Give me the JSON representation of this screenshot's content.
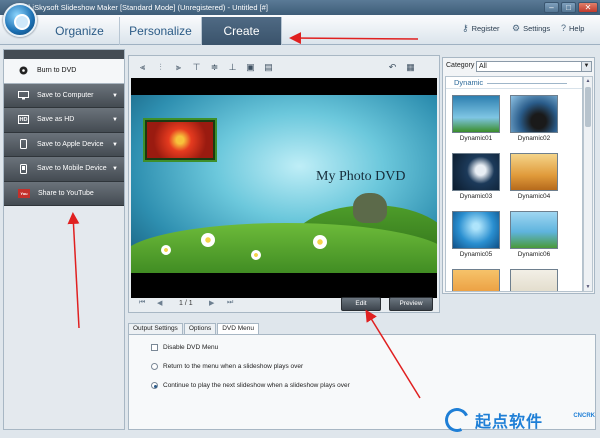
{
  "window": {
    "title": "[#] iSkysoft Slideshow Maker [Standard Mode] (Unregistered) - Untitled [#]",
    "controls": [
      "minimize",
      "maximize",
      "close"
    ]
  },
  "header": {
    "tabs": [
      {
        "label": "Organize",
        "active": false
      },
      {
        "label": "Personalize",
        "active": false
      },
      {
        "label": "Create",
        "active": true
      }
    ],
    "links": [
      {
        "label": "Register",
        "icon": "key-icon"
      },
      {
        "label": "Settings",
        "icon": "gear-icon"
      },
      {
        "label": "Help",
        "icon": "help-icon"
      }
    ]
  },
  "sidebar": {
    "items": [
      {
        "label": "Burn to DVD",
        "icon": "disc-icon",
        "active": true
      },
      {
        "label": "Save to Computer",
        "icon": "monitor-icon"
      },
      {
        "label": "Save as HD",
        "icon": "hd-icon"
      },
      {
        "label": "Save to Apple Device",
        "icon": "phone-icon"
      },
      {
        "label": "Save to Mobile Device",
        "icon": "mobile-icon"
      },
      {
        "label": "Share to YouTube",
        "icon": "youtube-icon"
      }
    ]
  },
  "preview": {
    "menu_title": "My Photo DVD",
    "page_indicator": "1 / 1",
    "edit_label": "Edit",
    "preview_label": "Preview"
  },
  "category": {
    "label": "Category",
    "selected": "All",
    "group": "Dynamic",
    "themes": [
      "Dynamic01",
      "Dynamic02",
      "Dynamic03",
      "Dynamic04",
      "Dynamic05",
      "Dynamic06"
    ]
  },
  "settings": {
    "tabs": [
      {
        "label": "Output Settings",
        "active": false
      },
      {
        "label": "Options",
        "active": false
      },
      {
        "label": "DVD Menu",
        "active": true
      }
    ],
    "disable_dvd_menu": "Disable DVD Menu",
    "return_option": "Return to the menu when a slideshow plays over",
    "continue_option": "Continue to play the next slideshow when a slideshow plays over"
  },
  "watermark": {
    "text": "起点软件",
    "sub": "CNCRK"
  },
  "colors": {
    "accent": "#2b5b86",
    "active_tab": "#3e5770",
    "arrow": "#e02020"
  }
}
